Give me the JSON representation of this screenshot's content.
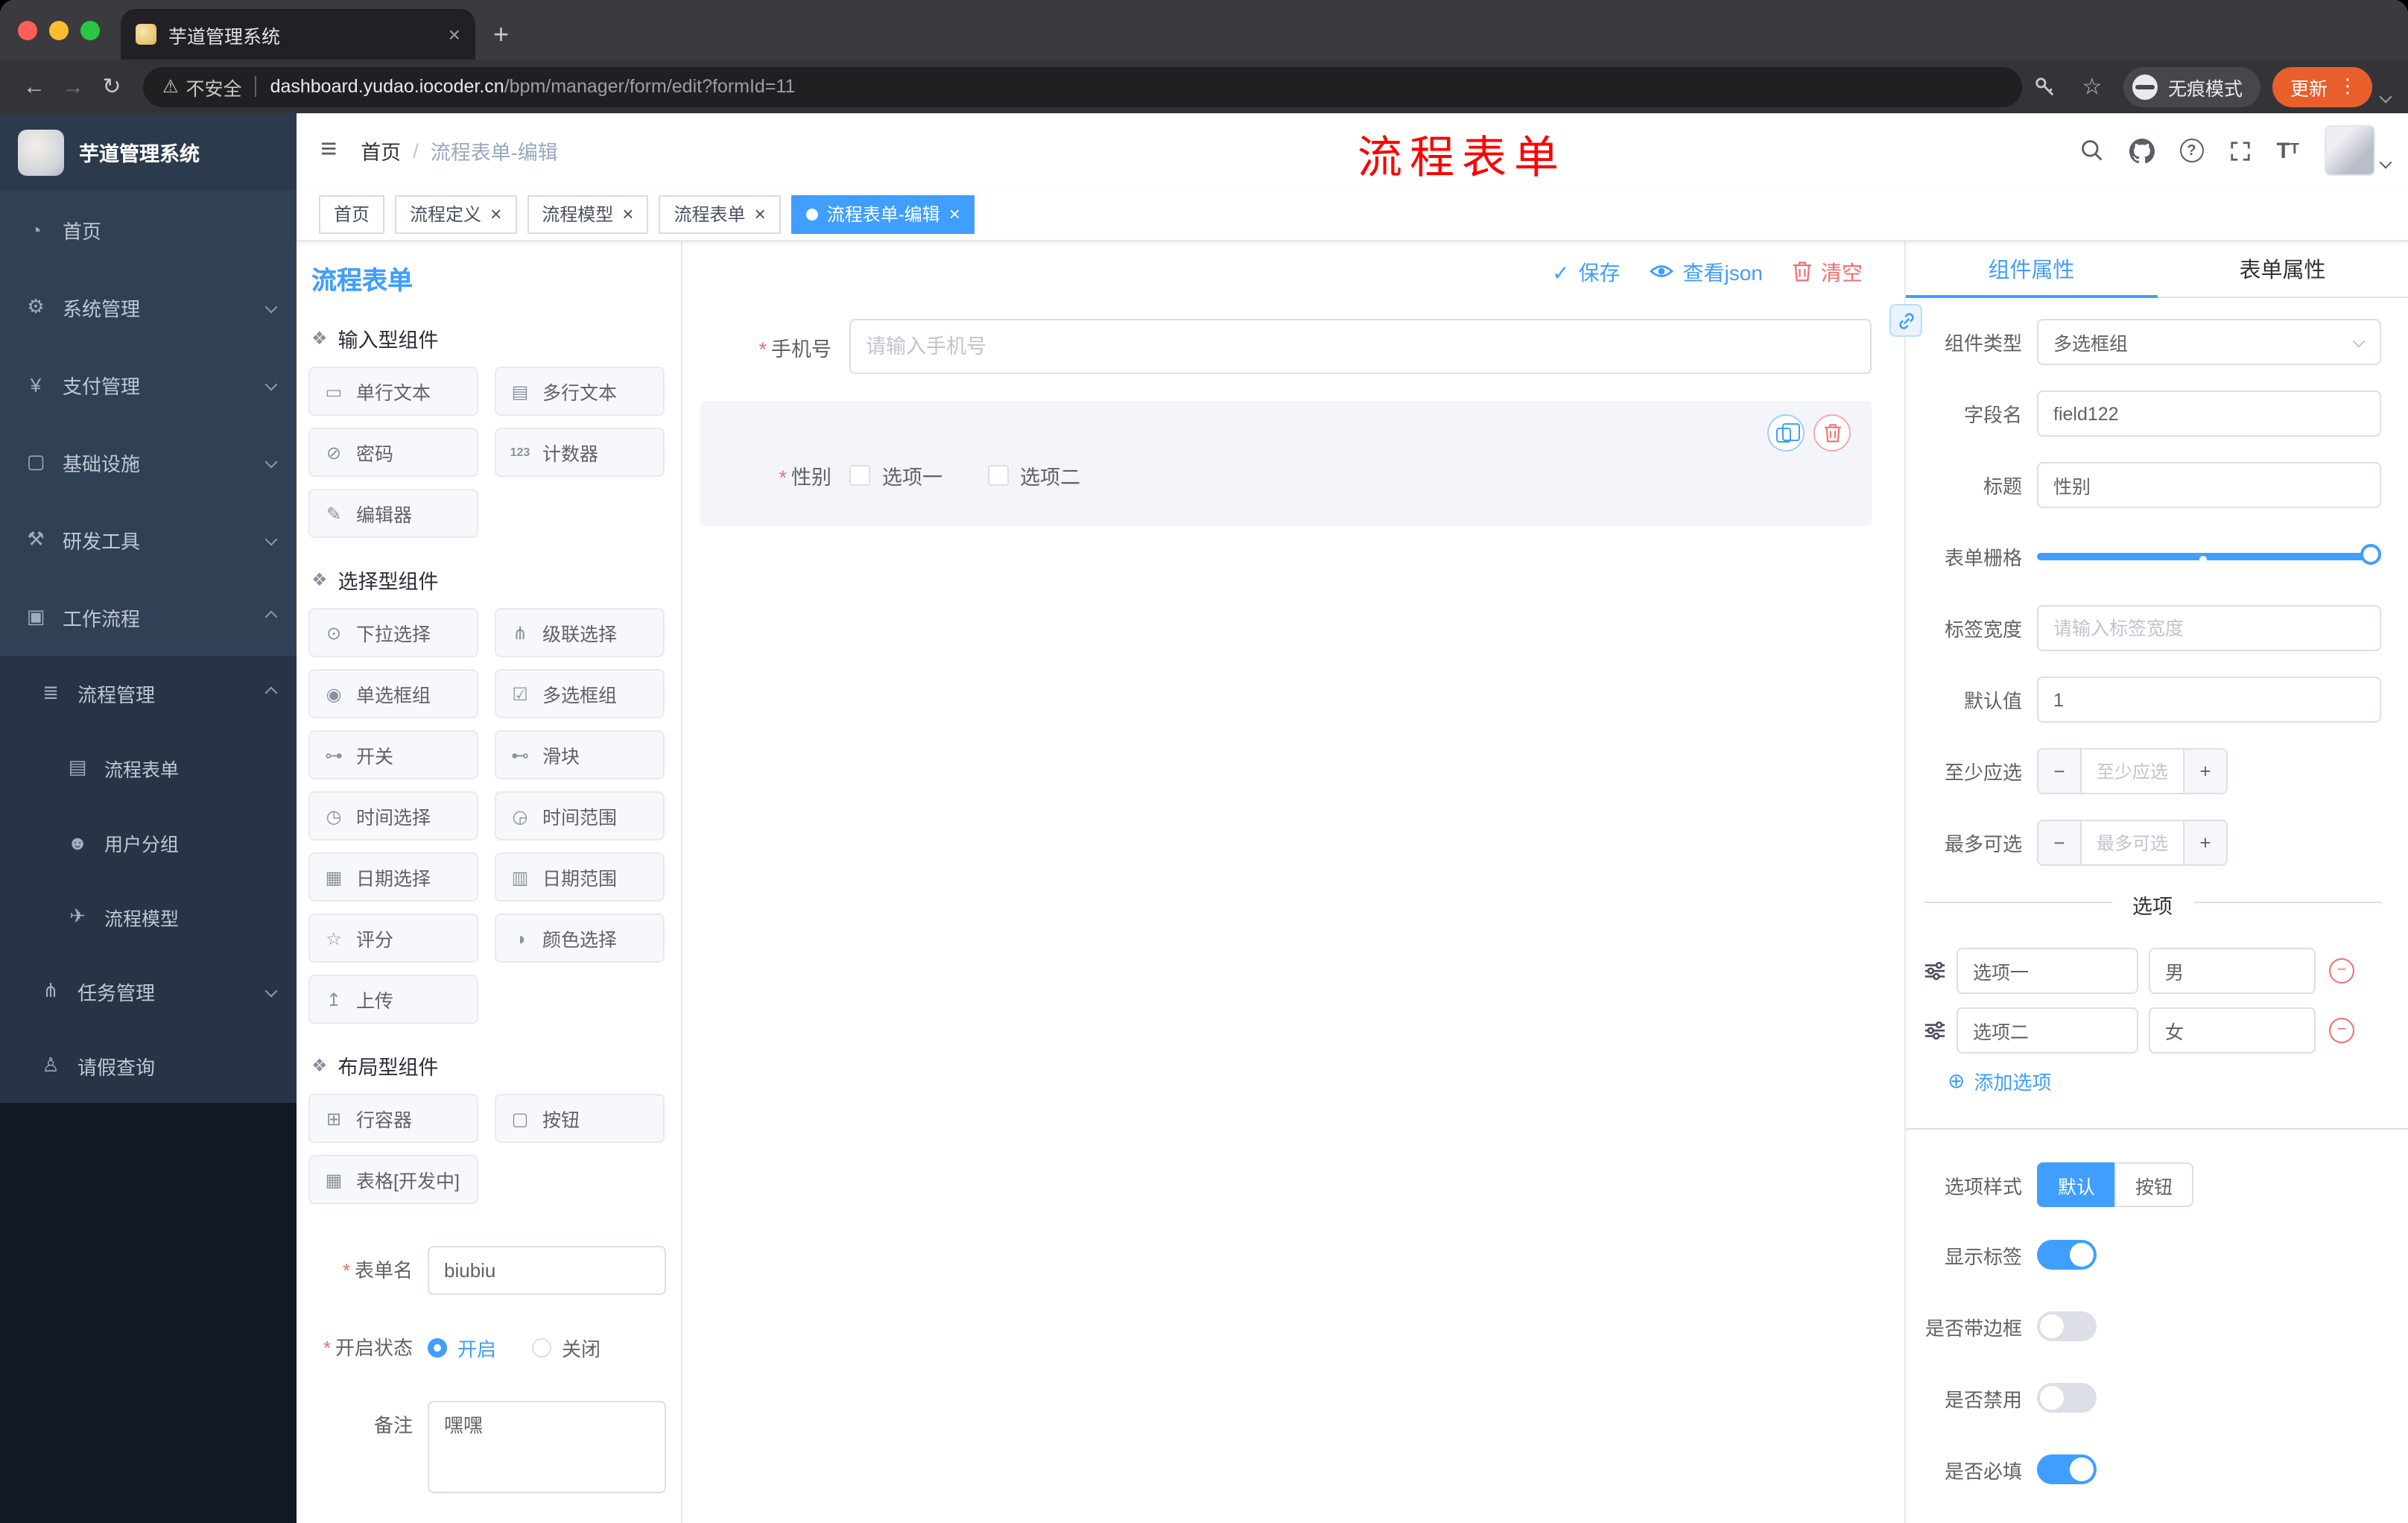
{
  "glyphs": {
    "dashboard-icon": "◔",
    "gear-icon": "⚙",
    "yen-icon": "¥",
    "monitor-icon": "▢",
    "tools-icon": "⚒",
    "suitcase-icon": "▣",
    "list-tree-icon": "≣",
    "document-icon": "▤",
    "users-icon": "☻",
    "send-icon": "✈",
    "branch-icon": "⋔",
    "person-icon": "♙",
    "section-cube-icon": "❖",
    "single-line-icon": "▭",
    "textarea-icon": "▤",
    "password-icon": "⊘",
    "counter-icon": "123",
    "editor-icon": "✎",
    "select-icon": "⊙",
    "cascader-icon": "⋔",
    "radio-icon": "◉",
    "checkbox-icon": "☑",
    "switch-icon": "⊶",
    "slider-icon": "⊷",
    "time-icon": "◷",
    "time-range-icon": "◶",
    "date-icon": "▦",
    "date-range-icon": "▥",
    "rate-icon": "☆",
    "color-icon": "◑",
    "upload-icon": "↥",
    "row-icon": "⊞",
    "button-icon": "▢",
    "table-icon": "▦",
    "back-icon": "←",
    "forward-icon": "→",
    "reload-icon": "↻",
    "warning-icon": "⚠",
    "star-icon": "☆",
    "kebab-icon": "⋮",
    "close-icon": "×",
    "plus-icon": "+",
    "hamburger-icon": "≡",
    "check-icon": "✓",
    "dot-icon": "●",
    "add-circle-icon": "⊕",
    "minus-icon": "−",
    "question-icon": "?",
    "font-size-icon": "T"
  },
  "browser": {
    "tab_title": "芋道管理系统",
    "security_label": "不安全",
    "url_domain": "dashboard.yudao.iocoder.cn",
    "url_path": "/bpm/manager/form/edit?formId=11",
    "incognito_label": "无痕模式",
    "update_label": "更新"
  },
  "sidebar": {
    "logo_title": "芋道管理系统",
    "items": [
      {
        "label": "首页"
      },
      {
        "label": "系统管理"
      },
      {
        "label": "支付管理"
      },
      {
        "label": "基础设施"
      },
      {
        "label": "研发工具"
      },
      {
        "label": "工作流程"
      }
    ],
    "submenu": {
      "process": {
        "label": "流程管理",
        "children": [
          {
            "label": "流程表单"
          },
          {
            "label": "用户分组"
          },
          {
            "label": "流程模型"
          }
        ]
      },
      "tasks": {
        "label": "任务管理"
      },
      "leave": {
        "label": "请假查询"
      }
    }
  },
  "header": {
    "breadcrumb_home": "首页",
    "breadcrumb_sep": "/",
    "breadcrumb_current": "流程表单-编辑",
    "annotation": "流程表单"
  },
  "tags": [
    {
      "label": "首页"
    },
    {
      "label": "流程定义"
    },
    {
      "label": "流程模型"
    },
    {
      "label": "流程表单"
    },
    {
      "label": "流程表单-编辑"
    }
  ],
  "builder": {
    "title": "流程表单",
    "groups": [
      {
        "title": "输入型组件",
        "items": [
          "单行文本",
          "多行文本",
          "密码",
          "计数器",
          "编辑器"
        ]
      },
      {
        "title": "选择型组件",
        "items": [
          "下拉选择",
          "级联选择",
          "单选框组",
          "多选框组",
          "开关",
          "滑块",
          "时间选择",
          "时间范围",
          "日期选择",
          "日期范围",
          "评分",
          "颜色选择",
          "上传"
        ]
      },
      {
        "title": "布局型组件",
        "items": [
          "行容器",
          "按钮",
          "表格[开发中]"
        ]
      }
    ],
    "meta": {
      "required_mark": "*",
      "name_label": "表单名",
      "name_value": "biubiu",
      "status_label": "开启状态",
      "status_on": "开启",
      "status_off": "关闭",
      "status_value": "开启",
      "remark_label": "备注",
      "remark_value": "嘿嘿"
    }
  },
  "canvas": {
    "toolbar": {
      "save": "保存",
      "view_json": "查看json",
      "clear": "清空"
    },
    "phone": {
      "label": "手机号",
      "placeholder": "请输入手机号"
    },
    "gender": {
      "label": "性别",
      "option1": "选项一",
      "option2": "选项二"
    }
  },
  "properties": {
    "tab_component": "组件属性",
    "tab_form": "表单属性",
    "component_type_label": "组件类型",
    "component_type_value": "多选框组",
    "field_name_label": "字段名",
    "field_name_value": "field122",
    "title_label": "标题",
    "title_value": "性别",
    "grid_label": "表单栅格",
    "label_width_label": "标签宽度",
    "label_width_placeholder": "请输入标签宽度",
    "default_label": "默认值",
    "default_value": "1",
    "min_label": "至少应选",
    "min_placeholder": "至少应选",
    "max_label": "最多可选",
    "max_placeholder": "最多可选",
    "options_title": "选项",
    "options": [
      {
        "label": "选项一",
        "value": "男"
      },
      {
        "label": "选项二",
        "value": "女"
      }
    ],
    "add_option_label": "添加选项",
    "style_label": "选项样式",
    "style_default": "默认",
    "style_button": "按钮",
    "switches": [
      {
        "label": "显示标签",
        "on": true
      },
      {
        "label": "是否带边框",
        "on": false
      },
      {
        "label": "是否禁用",
        "on": false
      },
      {
        "label": "是否必填",
        "on": true
      }
    ]
  }
}
